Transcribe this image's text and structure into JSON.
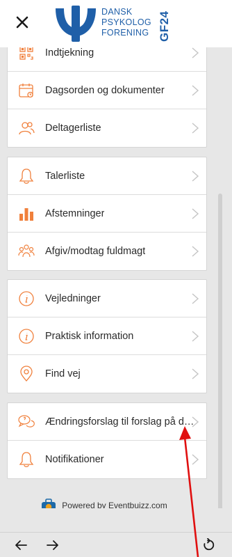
{
  "header": {
    "logo_line1": "DANSK",
    "logo_line2": "PSYKOLOG",
    "logo_line3": "FORENING",
    "badge": "GF24"
  },
  "menu": {
    "group1": [
      {
        "label": "Indtjekning",
        "icon": "qr-code-icon"
      },
      {
        "label": "Dagsorden og dokumenter",
        "icon": "calendar-icon"
      },
      {
        "label": "Deltagerliste",
        "icon": "people-icon"
      }
    ],
    "group2": [
      {
        "label": "Talerliste",
        "icon": "bell-icon"
      },
      {
        "label": "Afstemninger",
        "icon": "bar-chart-icon"
      },
      {
        "label": "Afgiv/modtag fuldmagt",
        "icon": "group-icon"
      }
    ],
    "group3": [
      {
        "label": "Vejledninger",
        "icon": "info-icon"
      },
      {
        "label": "Praktisk information",
        "icon": "info-icon"
      },
      {
        "label": "Find vej",
        "icon": "location-pin-icon"
      }
    ],
    "group4": [
      {
        "label": "Ændringsforslag til forslag på dagsordenen",
        "icon": "speech-bubbles-icon"
      },
      {
        "label": "Notifikationer",
        "icon": "bell-icon"
      }
    ]
  },
  "footer": {
    "powered_by": "Powered by Eventbuizz.com"
  },
  "colors": {
    "accent": "#f0803c",
    "brand_blue": "#1f5fa8",
    "annotation_arrow": "#e01010"
  }
}
